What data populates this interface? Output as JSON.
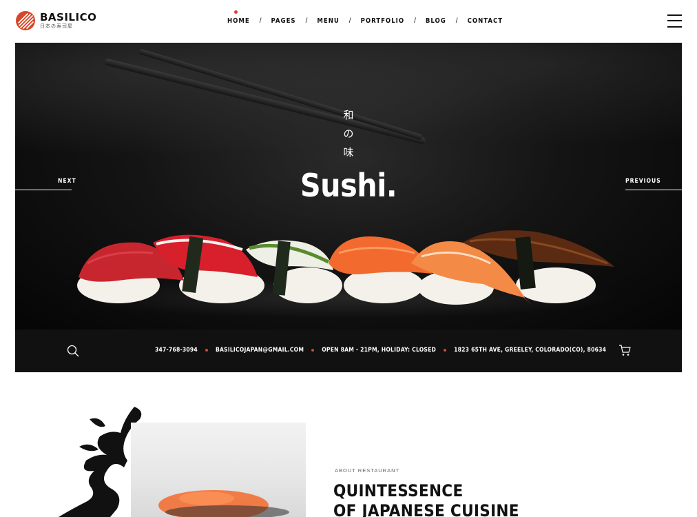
{
  "brand": {
    "name": "BASILICO",
    "tagline": "日本の寿司屋",
    "accent_color": "#d6472a"
  },
  "nav": {
    "items": [
      {
        "label": "HOME",
        "active": true
      },
      {
        "label": "PAGES"
      },
      {
        "label": "MENU"
      },
      {
        "label": "PORTFOLIO"
      },
      {
        "label": "BLOG"
      },
      {
        "label": "CONTACT"
      }
    ],
    "separator": "/",
    "menu_icon": "hamburger-icon"
  },
  "hero": {
    "kanji": [
      "和",
      "の",
      "味"
    ],
    "title": "Sushi.",
    "next_label": "NEXT",
    "previous_label": "PREVIOUS"
  },
  "infobar": {
    "phone": "347-768-3094",
    "email": "BASILICOJAPAN@GMAIL.COM",
    "hours": "OPEN 8AM - 21PM, HOLIDAY: CLOSED",
    "address": "1823 65TH AVE, GREELEY, COLORADO(CO), 80634",
    "search_icon": "search-icon",
    "cart_icon": "cart-icon"
  },
  "about": {
    "label": "ABOUT RESTAURANT",
    "title_line1": "QUINTESSENCE",
    "title_line2": "OF JAPANESE CUISINE"
  }
}
